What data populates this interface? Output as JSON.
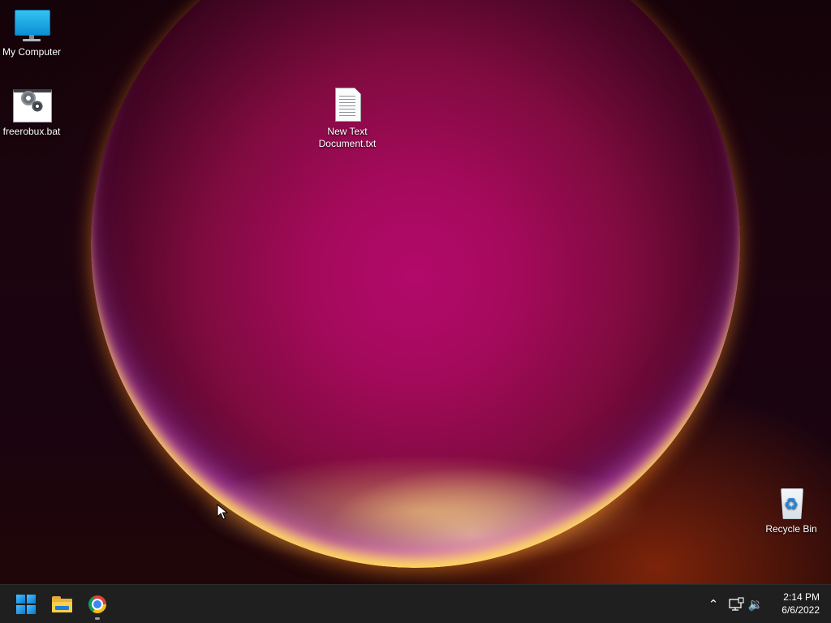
{
  "desktop": {
    "icons": [
      {
        "label": "My Computer",
        "icon": "monitor-icon"
      },
      {
        "label": "freerobux.bat",
        "icon": "batch-file-icon"
      },
      {
        "label": "New Text Document.txt",
        "icon": "text-document-icon"
      },
      {
        "label": "Recycle Bin",
        "icon": "recycle-bin-icon"
      }
    ]
  },
  "taskbar": {
    "pinned": [
      {
        "name": "Start",
        "icon": "windows-start-icon"
      },
      {
        "name": "File Explorer",
        "icon": "folder-icon"
      },
      {
        "name": "Google Chrome",
        "icon": "chrome-icon",
        "running": true
      }
    ],
    "tray": {
      "icons": [
        "chevron-up-icon",
        "network-icon",
        "volume-icon"
      ],
      "chevron_glyph": "⌃",
      "volume_glyph": "🔉"
    },
    "clock": {
      "time": "2:14 PM",
      "date": "6/6/2022"
    }
  },
  "colors": {
    "taskbar_bg": "#1f1f1f",
    "accent": "#0078d4",
    "wallpaper_center": "#b3096b"
  }
}
